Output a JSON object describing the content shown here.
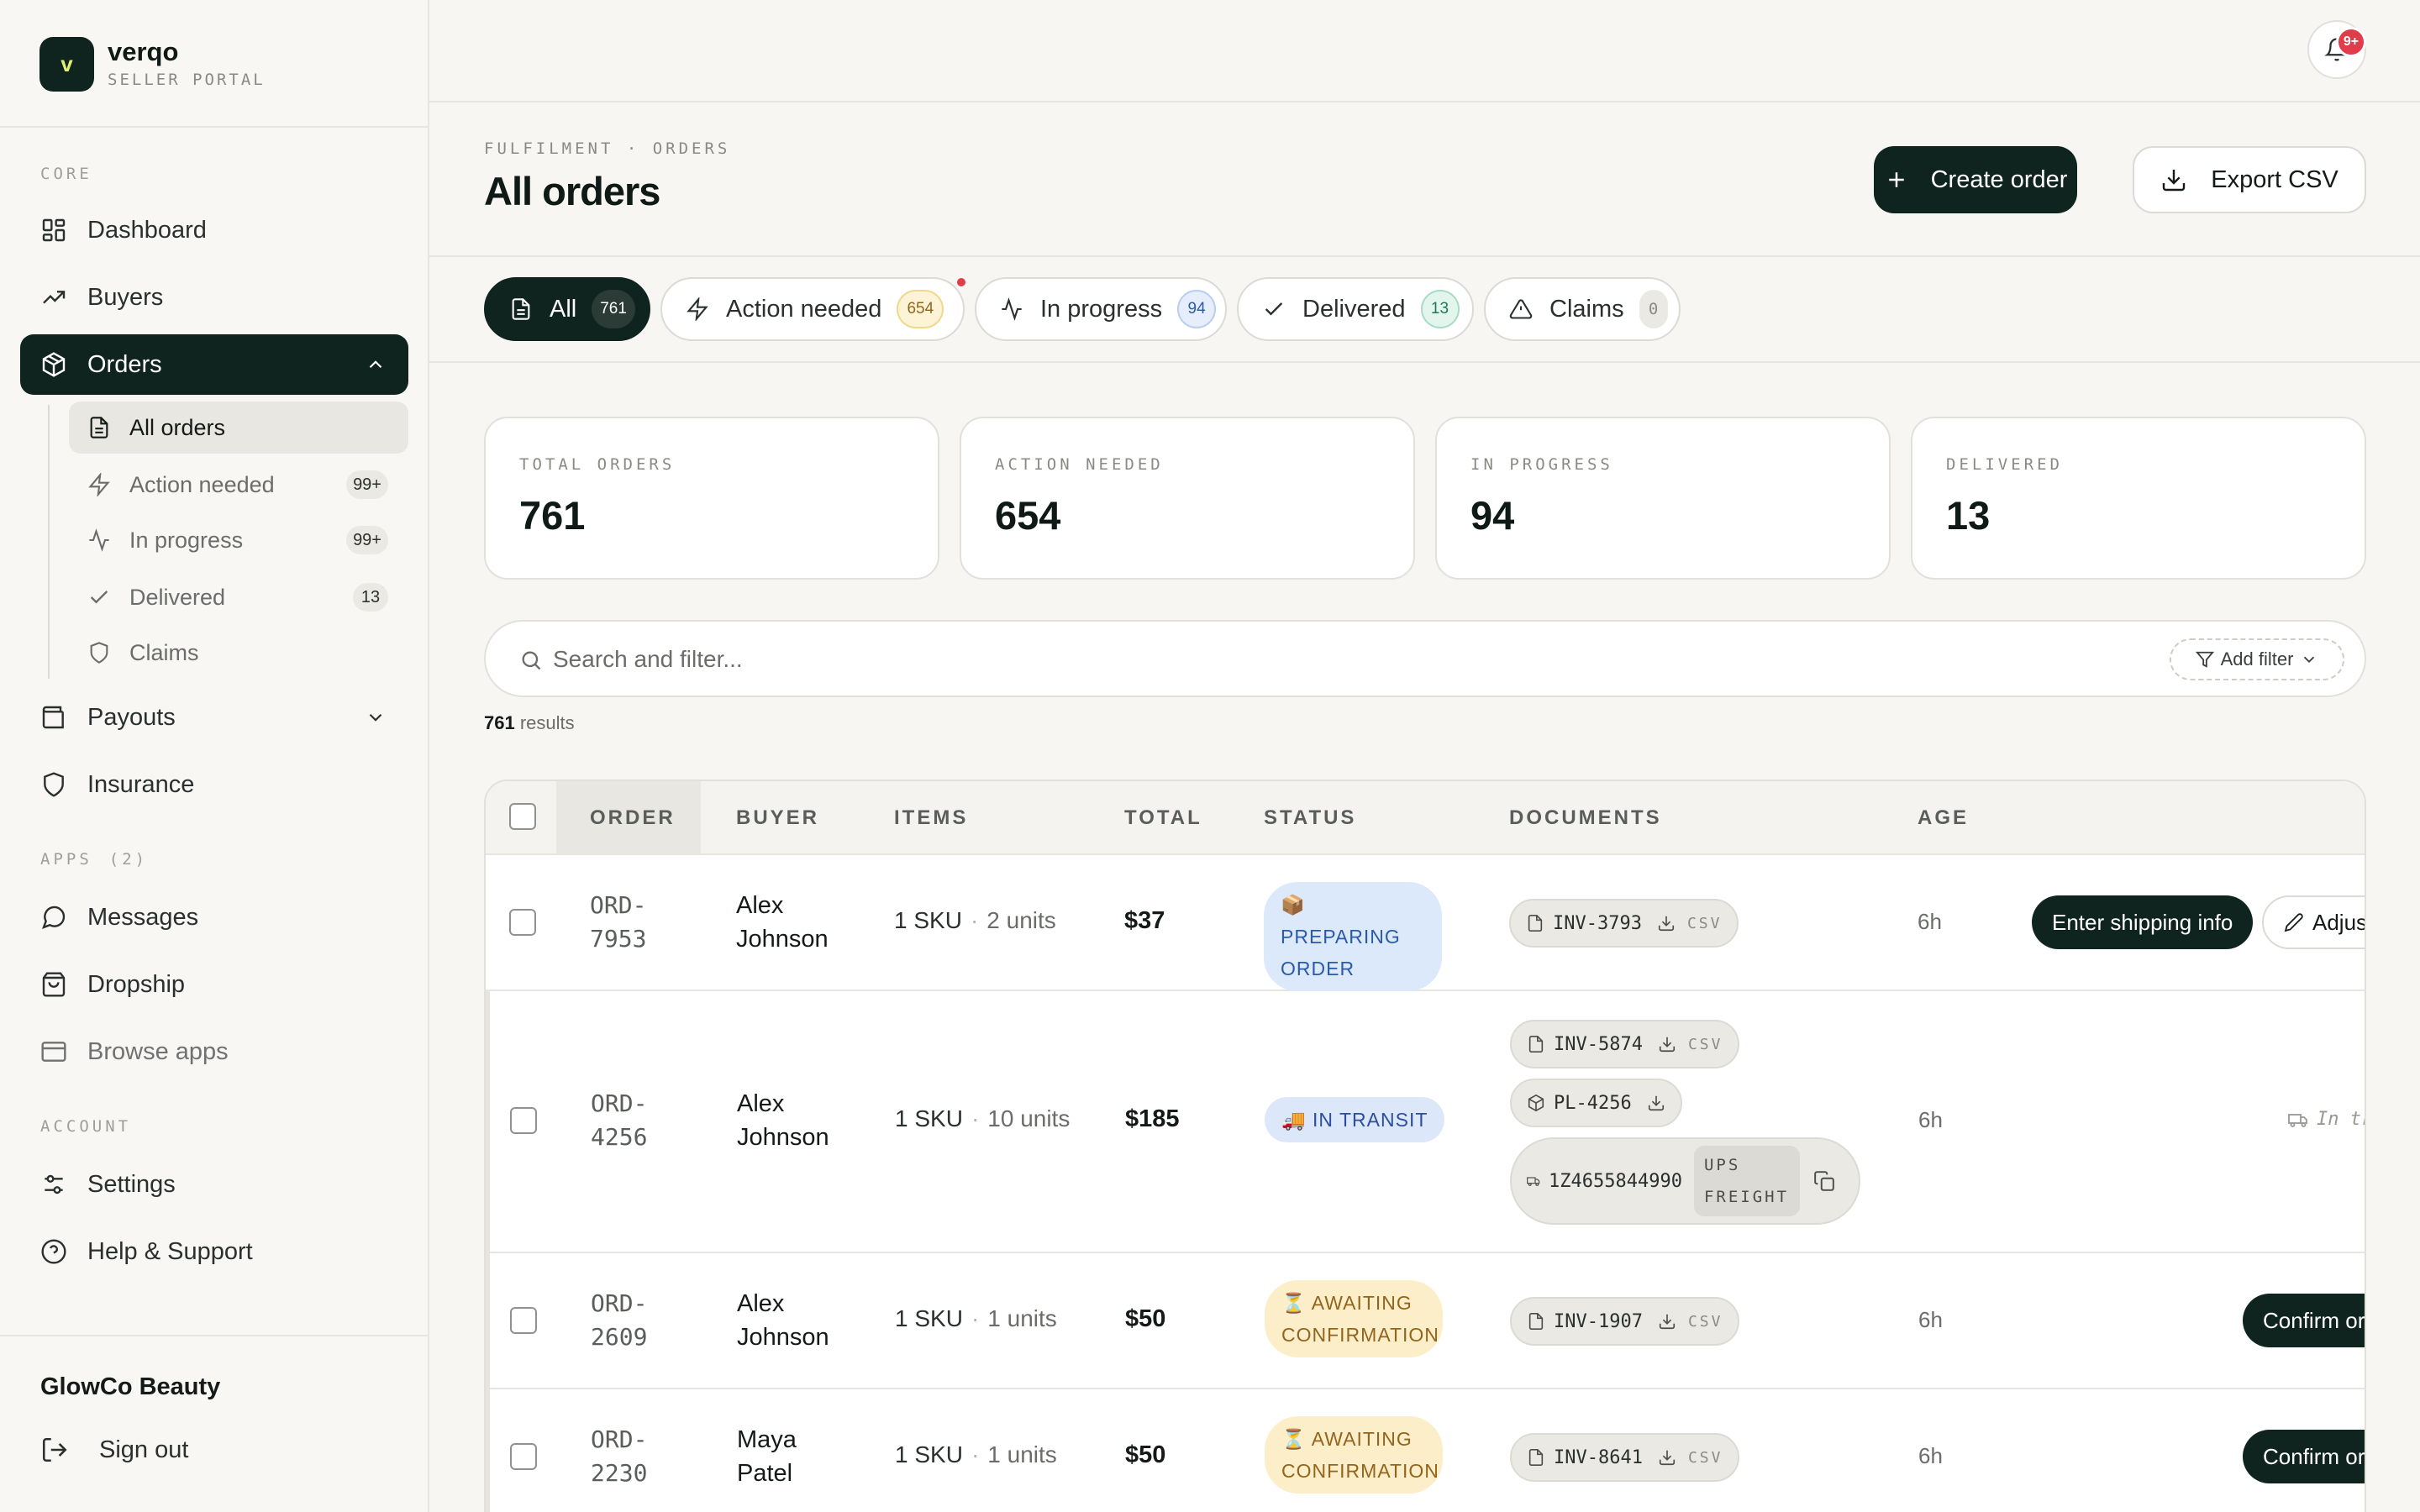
{
  "brand": {
    "name": "verqo",
    "subtitle": "SELLER PORTAL",
    "logo_letter": "v"
  },
  "sidebar": {
    "core_label": "CORE",
    "dashboard": "Dashboard",
    "buyers": "Buyers",
    "orders": "Orders",
    "orders_sub": [
      {
        "label": "All orders",
        "badge": ""
      },
      {
        "label": "Action needed",
        "badge": "99+"
      },
      {
        "label": "In progress",
        "badge": "99+"
      },
      {
        "label": "Delivered",
        "badge": "13"
      },
      {
        "label": "Claims",
        "badge": ""
      }
    ],
    "payouts": "Payouts",
    "insurance": "Insurance",
    "apps_label": "APPS",
    "apps_count": "(2)",
    "messages": "Messages",
    "dropship": "Dropship",
    "browse_apps": "Browse apps",
    "account_label": "ACCOUNT",
    "settings": "Settings",
    "help": "Help & Support",
    "shop_name": "GlowCo Beauty",
    "sign_out": "Sign out"
  },
  "topbar": {
    "notif_badge": "9+"
  },
  "header": {
    "breadcrumb": "FULFILMENT · ORDERS",
    "title": "All orders",
    "create_label": "Create order",
    "export_label": "Export CSV"
  },
  "tabs": [
    {
      "label": "All",
      "count": "761"
    },
    {
      "label": "Action needed",
      "count": "654"
    },
    {
      "label": "In progress",
      "count": "94"
    },
    {
      "label": "Delivered",
      "count": "13"
    },
    {
      "label": "Claims",
      "count": "0"
    }
  ],
  "stats": [
    {
      "label": "TOTAL ORDERS",
      "value": "761"
    },
    {
      "label": "ACTION NEEDED",
      "value": "654"
    },
    {
      "label": "IN PROGRESS",
      "value": "94"
    },
    {
      "label": "DELIVERED",
      "value": "13"
    }
  ],
  "search": {
    "placeholder": "Search and filter...",
    "add_filter": "Add filter"
  },
  "results": {
    "count": "761",
    "label": "results"
  },
  "table": {
    "columns": [
      "ORDER",
      "BUYER",
      "ITEMS",
      "TOTAL",
      "STATUS",
      "DOCUMENTS",
      "AGE"
    ],
    "rows": [
      {
        "order_a": "ORD-",
        "order_b": "7953",
        "buyer_a": "Alex",
        "buyer_b": "Johnson",
        "sku": "1 SKU",
        "units": "2 units",
        "total": "$37",
        "status_a": "📦 PREPARING",
        "status_b": "ORDER",
        "inv": "INV-3793",
        "csv": "CSV",
        "age": "6h",
        "action": "Enter shipping info",
        "action2": "Adjust"
      },
      {
        "order_a": "ORD-",
        "order_b": "4256",
        "buyer_a": "Alex",
        "buyer_b": "Johnson",
        "sku": "1 SKU",
        "units": "10 units",
        "total": "$185",
        "status": "🚚 IN TRANSIT",
        "inv": "INV-5874",
        "csv": "CSV",
        "pl": "PL-4256",
        "tracking": "1Z4655844990",
        "carrier_a": "UPS",
        "carrier_b": "FREIGHT",
        "age": "6h",
        "in_transit": "In tr"
      },
      {
        "order_a": "ORD-",
        "order_b": "2609",
        "buyer_a": "Alex",
        "buyer_b": "Johnson",
        "sku": "1 SKU",
        "units": "1 units",
        "total": "$50",
        "status_a": "⏳ AWAITING",
        "status_b": "CONFIRMATION",
        "inv": "INV-1907",
        "csv": "CSV",
        "age": "6h",
        "action": "Confirm ord"
      },
      {
        "order_a": "ORD-",
        "order_b": "2230",
        "buyer_a": "Maya",
        "buyer_b": "Patel",
        "sku": "1 SKU",
        "units": "1 units",
        "total": "$50",
        "status_a": "⏳ AWAITING",
        "status_b": "CONFIRMATION",
        "inv": "INV-8641",
        "csv": "CSV",
        "age": "6h",
        "action": "Confirm ord"
      }
    ]
  },
  "colors": {
    "primary": "#0f241e",
    "accent_logo": "#e2f071",
    "alert": "#e03c4a"
  }
}
